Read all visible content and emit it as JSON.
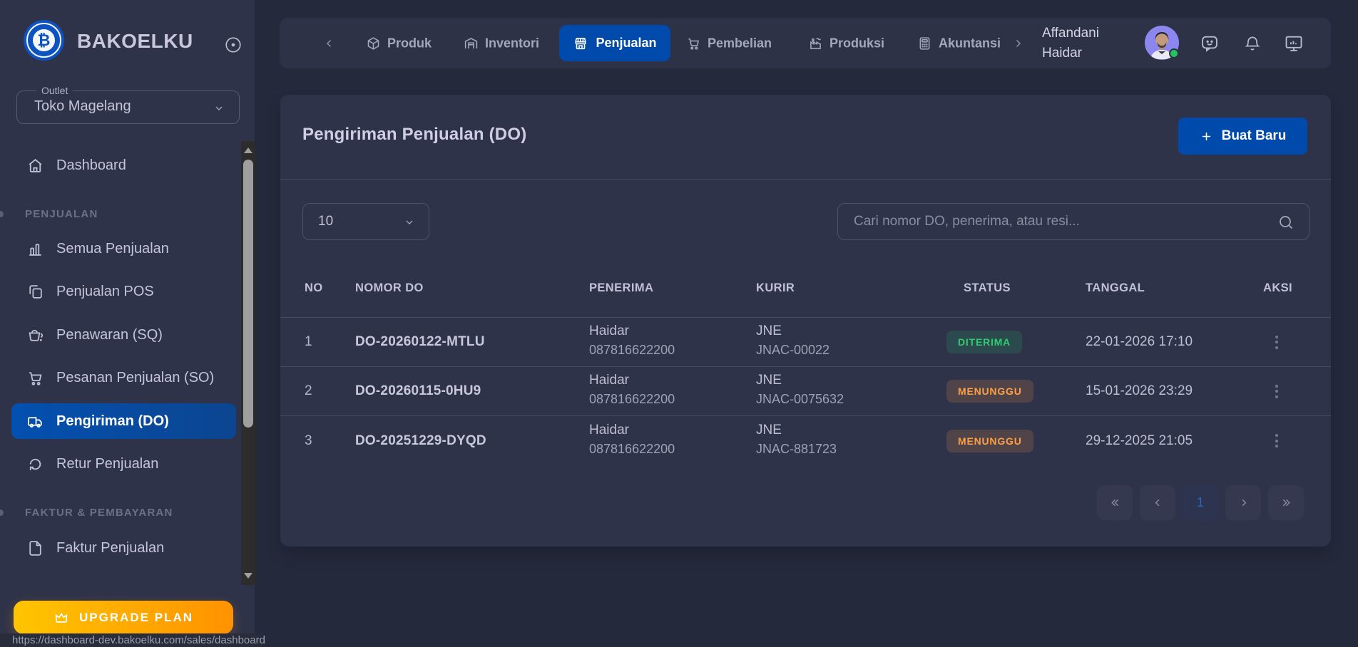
{
  "sidebar": {
    "brand": "BAKOELKU",
    "outlet_label": "Outlet",
    "outlet_value": "Toko Magelang",
    "items": {
      "dashboard": "Dashboard",
      "section_sales": "PENJUALAN",
      "semua": "Semua Penjualan",
      "pos": "Penjualan POS",
      "sq": "Penawaran (SQ)",
      "so": "Pesanan Penjualan (SO)",
      "do": "Pengiriman (DO)",
      "retur": "Retur Penjualan",
      "section_invoice": "FAKTUR & PEMBAYARAN",
      "faktur": "Faktur Penjualan"
    },
    "upgrade_label": "UPGRADE PLAN"
  },
  "topbar": {
    "nav": {
      "produk": "Produk",
      "inventori": "Inventori",
      "penjualan": "Penjualan",
      "pembelian": "Pembelian",
      "produksi": "Produksi",
      "akuntansi": "Akuntansi"
    },
    "user_line1": "Affandani",
    "user_line2": "Haidar"
  },
  "page": {
    "title": "Pengiriman Penjualan (DO)",
    "create_button": "Buat Baru",
    "page_size": "10",
    "search_placeholder": "Cari nomor DO, penerima, atau resi...",
    "status_url": "https://dashboard-dev.bakoelku.com/sales/dashboard"
  },
  "table": {
    "headers": {
      "no": "NO",
      "nomor": "NOMOR DO",
      "penerima": "PENERIMA",
      "kurir": "KURIR",
      "status": "STATUS",
      "tanggal": "TANGGAL",
      "aksi": "AKSI"
    },
    "rows": [
      {
        "no": "1",
        "nomor": "DO-20260122-MTLU",
        "penerima": "Haidar",
        "telepon": "087816622200",
        "kurir": "JNE",
        "resi": "JNAC-00022",
        "status": "DITERIMA",
        "status_type": "success",
        "tanggal": "22-01-2026 17:10"
      },
      {
        "no": "2",
        "nomor": "DO-20260115-0HU9",
        "penerima": "Haidar",
        "telepon": "087816622200",
        "kurir": "JNE",
        "resi": "JNAC-0075632",
        "status": "MENUNGGU",
        "status_type": "warning",
        "tanggal": "15-01-2026 23:29"
      },
      {
        "no": "3",
        "nomor": "DO-20251229-DYQD",
        "penerima": "Haidar",
        "telepon": "087816622200",
        "kurir": "JNE",
        "resi": "JNAC-881723",
        "status": "MENUNGGU",
        "status_type": "warning",
        "tanggal": "29-12-2025 21:05"
      }
    ],
    "pagination": {
      "current": "1"
    }
  },
  "colors": {
    "accent": "#004aab",
    "success_text": "#2ecc71",
    "warning_text": "#ff9e43",
    "upgrade_from": "#ffc500",
    "upgrade_to": "#ff9200"
  }
}
